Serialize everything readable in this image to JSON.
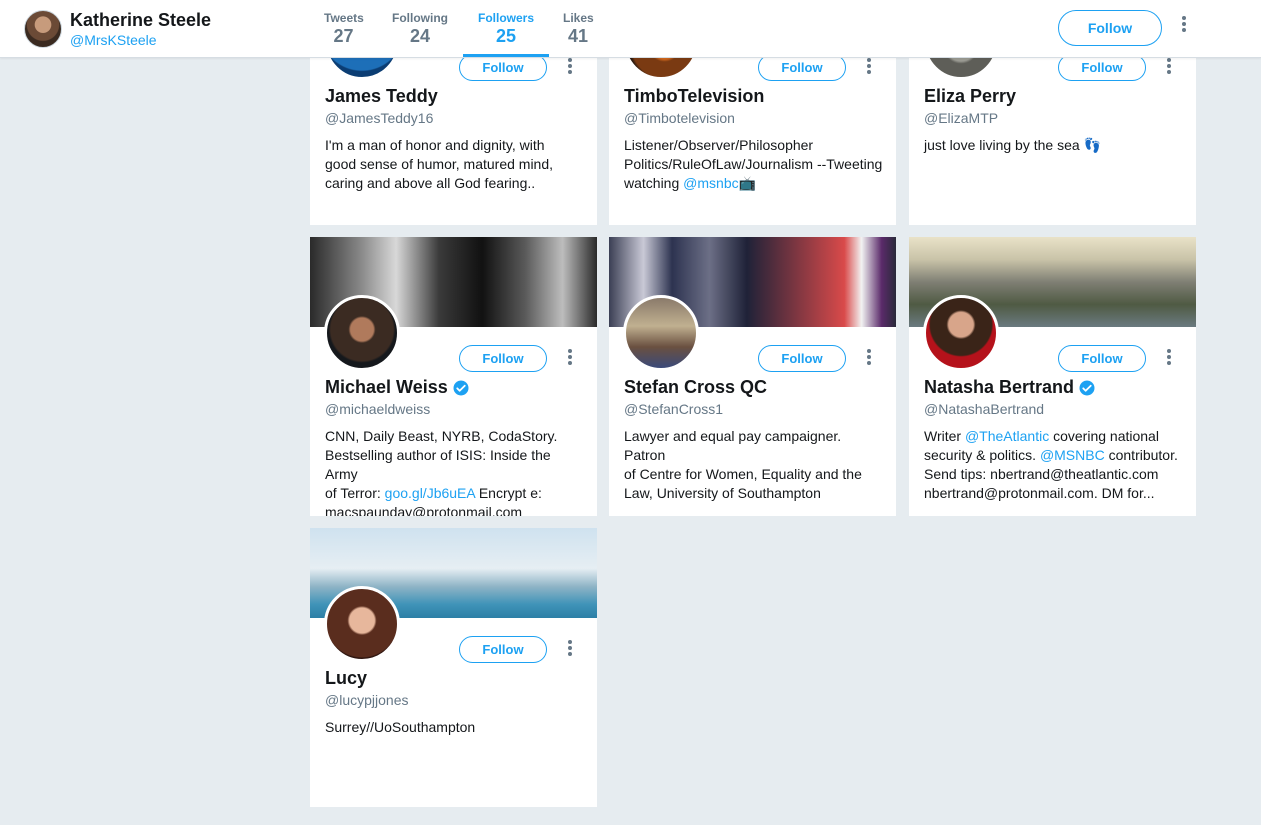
{
  "profile": {
    "name": "Katherine Steele",
    "handle": "@MrsKSteele",
    "follow_label": "Follow"
  },
  "stats": [
    {
      "label": "Tweets",
      "value": "27"
    },
    {
      "label": "Following",
      "value": "24"
    },
    {
      "label": "Followers",
      "value": "25"
    },
    {
      "label": "Likes",
      "value": "41"
    }
  ],
  "active_tab": "Followers",
  "colors": {
    "accent": "#1da1f2",
    "background": "#e6ecf0",
    "muted": "#657786"
  },
  "cards": [
    {
      "name": "James Teddy",
      "handle": "@JamesTeddy16",
      "verified": false,
      "follow_label": "Follow",
      "bio": [
        {
          "text": "I'm a man of honor and dignity, with\ngood sense of humor, matured mind,\ncaring and above all God fearing.."
        }
      ]
    },
    {
      "name": "TimboTelevision",
      "handle": "@Timbotelevision",
      "verified": false,
      "follow_label": "Follow",
      "bio": [
        {
          "text": "Listener/Observer/Philosopher\nPolitics/RuleOfLaw/Journalism --Tweeting\nwatching "
        },
        {
          "text": "@msnbc",
          "link": true
        },
        {
          "text": "📺"
        }
      ]
    },
    {
      "name": "Eliza Perry",
      "handle": "@ElizaMTP",
      "verified": false,
      "follow_label": "Follow",
      "bio": [
        {
          "text": "just love living by the sea 👣"
        }
      ]
    },
    {
      "name": "Michael Weiss",
      "handle": "@michaeldweiss",
      "verified": true,
      "follow_label": "Follow",
      "bio": [
        {
          "text": "CNN, Daily Beast, NYRB, CodaStory.\nBestselling author of ISIS: Inside the Army\nof Terror: "
        },
        {
          "text": "goo.gl/Jb6uEA",
          "link": true
        },
        {
          "text": " Encrypt e:\nmacspaunday@protonmail.com"
        }
      ]
    },
    {
      "name": "Stefan Cross QC",
      "handle": "@StefanCross1",
      "verified": false,
      "follow_label": "Follow",
      "bio": [
        {
          "text": "Lawyer and equal pay campaigner. Patron\nof Centre for Women, Equality and the\nLaw, University of Southampton"
        }
      ]
    },
    {
      "name": "Natasha Bertrand",
      "handle": "@NatashaBertrand",
      "verified": true,
      "follow_label": "Follow",
      "bio": [
        {
          "text": "Writer "
        },
        {
          "text": "@TheAtlantic",
          "link": true
        },
        {
          "text": " covering national\nsecurity & politics. "
        },
        {
          "text": "@MSNBC",
          "link": true
        },
        {
          "text": " contributor.\nSend tips: nbertrand@theatlantic.com\nnbertrand@protonmail.com. DM for..."
        }
      ]
    },
    {
      "name": "Lucy",
      "handle": "@lucypjjones",
      "verified": false,
      "follow_label": "Follow",
      "bio": [
        {
          "text": "Surrey//UoSouthampton"
        }
      ]
    }
  ]
}
